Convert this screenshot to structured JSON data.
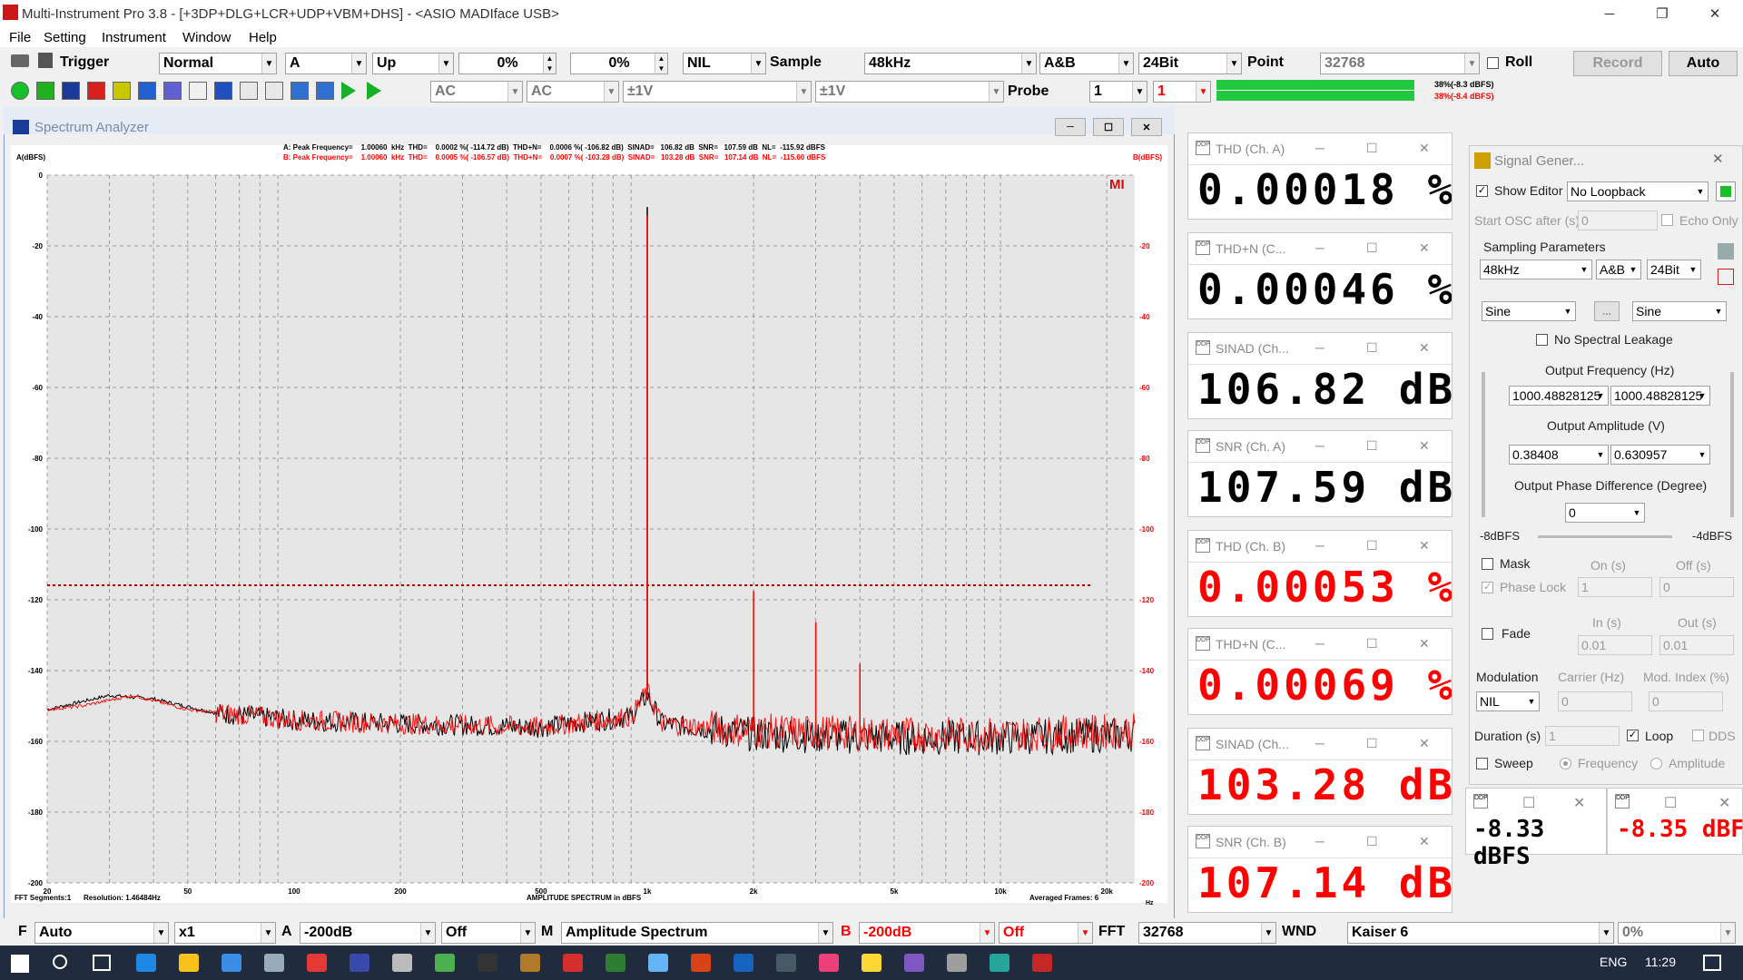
{
  "window": {
    "title": "Multi-Instrument Pro 3.8    -    [+3DP+DLG+LCR+UDP+VBM+DHS]    -    <ASIO MADIface USB>"
  },
  "menu": [
    "File",
    "Setting",
    "Instrument",
    "Window",
    "Help"
  ],
  "toolbar1": {
    "trigger": "Trigger",
    "mode": "Normal",
    "channel": "A",
    "edge": "Up",
    "level1": "0%",
    "level2": "0%",
    "nil": "NIL",
    "sample_label": "Sample",
    "sample_rate": "48kHz",
    "channels": "A&B",
    "bits": "24Bit",
    "point_label": "Point",
    "points": "32768",
    "roll": "Roll",
    "record": "Record",
    "auto": "Auto"
  },
  "toolbar2": {
    "coupling_a": "AC",
    "coupling_b": "AC",
    "range_a": "±1V",
    "range_b": "±1V",
    "probe_label": "Probe",
    "probe_a": "1",
    "probe_b": "1",
    "level_a": "38%(-8.3 dBFS)",
    "level_b": "38%(-8.4 dBFS)",
    "level_fraction": 0.38
  },
  "spectrum": {
    "title": "Spectrum Analyzer",
    "info_a": "A: Peak Frequency=    1.00060  kHz  THD=    0.0002 %( -114.72 dB)  THD+N=    0.0006 %( -106.82 dB)  SINAD=   106.82 dB  SNR=   107.59 dB  NL=  -115.92 dBFS",
    "info_b": "B: Peak Frequency=    1.00060  kHz  THD=    0.0005 %( -106.57 dB)  THD+N=    0.0007 %( -103.28 dB)  SINAD=   103.28 dB  SNR=   107.14 dB  NL=  -115.60 dBFS",
    "ylabel_a": "A(dBFS)",
    "ylabel_b": "B(dBFS)",
    "logo": "MI",
    "fft_segments": "FFT Segments:1",
    "resolution": "Resolution: 1.46484Hz",
    "xlabel": "AMPLITUDE SPECTRUM in dBFS",
    "averaged": "Averaged Frames: 6",
    "hz": "Hz"
  },
  "chart_data": {
    "type": "line",
    "title": "AMPLITUDE SPECTRUM in dBFS",
    "x_scale": "log",
    "xlim": [
      20,
      24000
    ],
    "ylim": [
      -200,
      0
    ],
    "yticks": [
      "0",
      "-20",
      "-40",
      "-60",
      "-80",
      "-100",
      "-120",
      "-140",
      "-160",
      "-180",
      "-200"
    ],
    "yticks_right": [
      "",
      "-20",
      "-40",
      "-60",
      "-80",
      "-100",
      "-120",
      "-140",
      "-160",
      "-180",
      "-200"
    ],
    "xticks": [
      {
        "v": 20,
        "t": "20"
      },
      {
        "v": 50,
        "t": "50"
      },
      {
        "v": 100,
        "t": "100"
      },
      {
        "v": 200,
        "t": "200"
      },
      {
        "v": 500,
        "t": "500"
      },
      {
        "v": 1000,
        "t": "1k"
      },
      {
        "v": 2000,
        "t": "2k"
      },
      {
        "v": 5000,
        "t": "5k"
      },
      {
        "v": 10000,
        "t": "10k"
      },
      {
        "v": 20000,
        "t": "20k"
      }
    ],
    "noise_floor": -115.9,
    "series": [
      {
        "name": "A",
        "color": "#000000",
        "points": [
          [
            20,
            -151
          ],
          [
            30,
            -147
          ],
          [
            40,
            -148
          ],
          [
            60,
            -152
          ],
          [
            100,
            -154
          ],
          [
            200,
            -155
          ],
          [
            500,
            -156
          ],
          [
            900,
            -153
          ],
          [
            1000,
            -147
          ],
          [
            1100,
            -155
          ],
          [
            2000,
            -158
          ],
          [
            5000,
            -159
          ],
          [
            10000,
            -159
          ],
          [
            24000,
            -158
          ]
        ],
        "peaks": [
          [
            1000,
            -9
          ]
        ]
      },
      {
        "name": "B",
        "color": "#ff0000",
        "points": [
          [
            20,
            -151
          ],
          [
            25,
            -150
          ],
          [
            35,
            -147
          ],
          [
            50,
            -151
          ],
          [
            100,
            -154
          ],
          [
            200,
            -155
          ],
          [
            500,
            -156
          ],
          [
            900,
            -153
          ],
          [
            1000,
            -146
          ],
          [
            1100,
            -155
          ],
          [
            2000,
            -157
          ],
          [
            5000,
            -158
          ],
          [
            10000,
            -158
          ],
          [
            24000,
            -157
          ]
        ],
        "peaks": [
          [
            1000,
            -11.5
          ],
          [
            2000,
            -117.5
          ],
          [
            3000,
            -126.3
          ],
          [
            4000,
            -138
          ]
        ]
      }
    ]
  },
  "meters": [
    {
      "title": "THD (Ch. A)",
      "value": "0.00018 %",
      "color": "#000000"
    },
    {
      "title": "THD+N (C...",
      "value": "0.00046 %",
      "color": "#000000"
    },
    {
      "title": "SINAD (Ch...",
      "value": "106.82 dB",
      "color": "#000000"
    },
    {
      "title": "SNR (Ch. A)",
      "value": "107.59 dB",
      "color": "#000000"
    },
    {
      "title": "THD (Ch. B)",
      "value": "0.00053 %",
      "color": "#ff0000"
    },
    {
      "title": "THD+N (C...",
      "value": "0.00069 %",
      "color": "#ff0000"
    },
    {
      "title": "SINAD (Ch...",
      "value": "103.28 dB",
      "color": "#ff0000"
    },
    {
      "title": "SNR (Ch. B)",
      "value": "107.14 dB",
      "color": "#ff0000"
    }
  ],
  "level_meters": [
    {
      "value": "-8.33 dBFS",
      "color": "#000000"
    },
    {
      "value": "-8.35 dBFS",
      "color": "#ff0000"
    }
  ],
  "siggen": {
    "title": "Signal Gener...",
    "show_editor": "Show Editor",
    "loopback": "No Loopback",
    "start_osc": "Start OSC after (s)",
    "start_osc_val": "0",
    "echo_only": "Echo Only",
    "sampling": "Sampling Parameters",
    "rate": "48kHz",
    "ch": "A&B",
    "bits": "24Bit",
    "wave_a": "Sine",
    "wave_b": "Sine",
    "dots": "...",
    "no_leak": "No Spectral Leakage",
    "out_freq": "Output Frequency (Hz)",
    "freq_a": "1000.48828125",
    "freq_b": "1000.48828125",
    "out_amp": "Output Amplitude (V)",
    "amp_a": "0.38408",
    "amp_b": "0.630957",
    "out_phase": "Output Phase Difference (Degree)",
    "phase": "0",
    "left_level": "-8dBFS",
    "right_level": "-4dBFS",
    "mask": "Mask",
    "on": "On (s)",
    "off": "Off (s)",
    "phase_lock": "Phase Lock",
    "on_val": "1",
    "off_val": "0",
    "fade": "Fade",
    "in": "In (s)",
    "out": "Out (s)",
    "in_val": "0.01",
    "out_val": "0.01",
    "modulation": "Modulation",
    "carrier": "Carrier (Hz)",
    "mod_index": "Mod. Index (%)",
    "mod_val": "NIL",
    "carrier_val": "0",
    "index_val": "0",
    "duration": "Duration (s)",
    "duration_val": "1",
    "loop": "Loop",
    "dds": "DDS",
    "sweep": "Sweep",
    "frequency": "Frequency",
    "amplitude": "Amplitude"
  },
  "bottom": {
    "f": "F",
    "f_val": "Auto",
    "mult": "x1",
    "a": "A",
    "a_range": "-200dB",
    "a_off": "Off",
    "m": "M",
    "mode": "Amplitude Spectrum",
    "b": "B",
    "b_range": "-200dB",
    "b_off": "Off",
    "fft": "FFT",
    "fft_val": "32768",
    "wnd": "WND",
    "window": "Kaiser 6",
    "pct": "0%"
  },
  "taskbar": {
    "lang": "ENG",
    "time": "11:29"
  }
}
